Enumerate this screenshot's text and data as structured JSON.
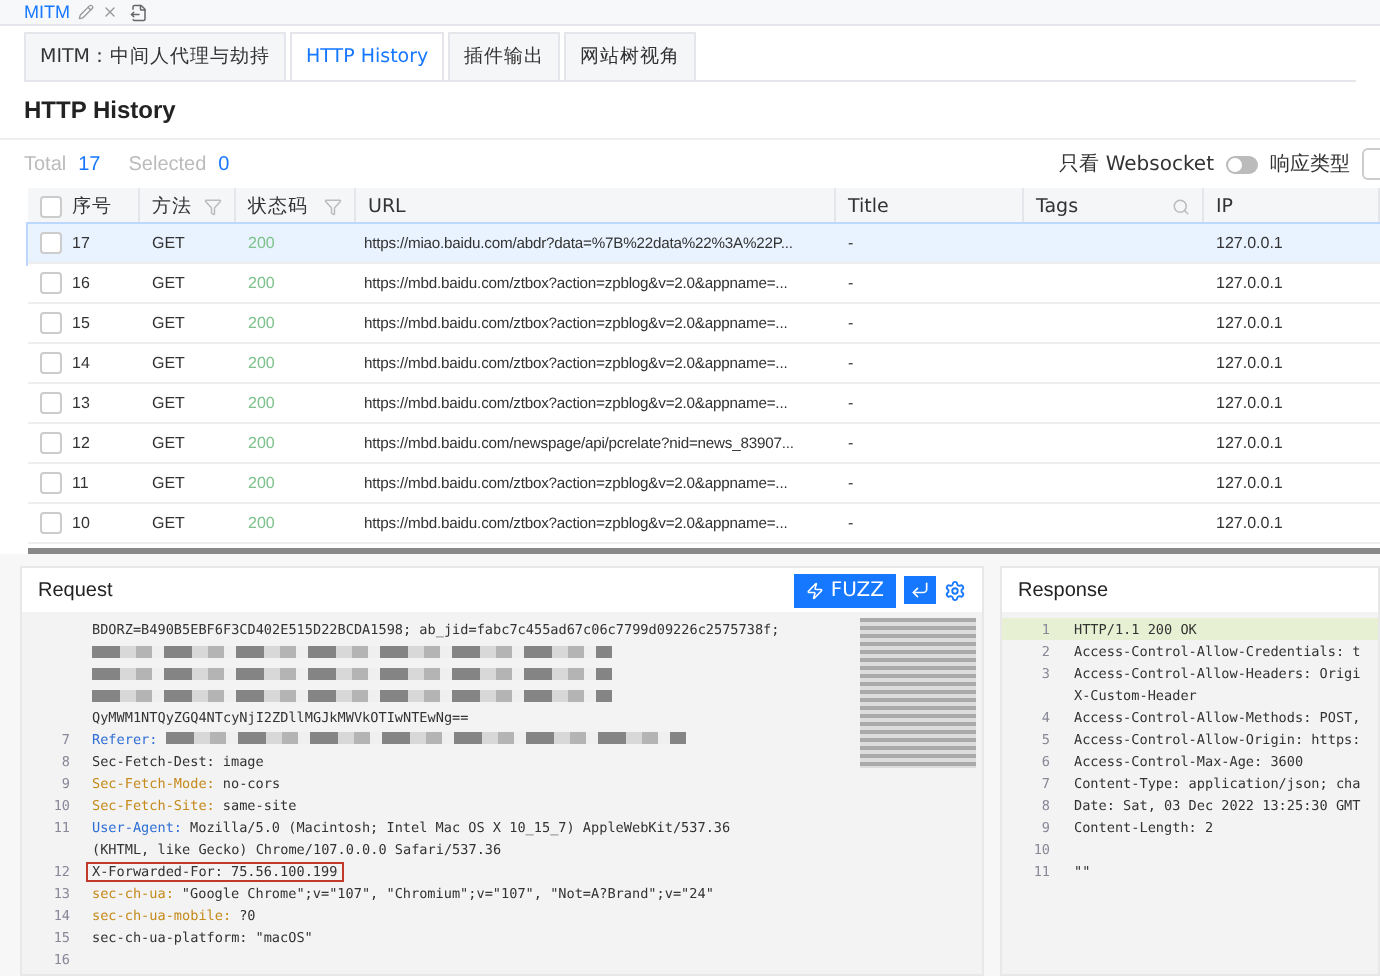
{
  "top_tab": {
    "label": "MITM"
  },
  "tabs": [
    {
      "label": "MITM：中间人代理与劫持",
      "selected": false
    },
    {
      "label": "HTTP History",
      "selected": true
    },
    {
      "label": "插件输出",
      "selected": false
    },
    {
      "label": "网站树视角",
      "selected": false
    }
  ],
  "title": "HTTP History",
  "summary": {
    "total_label": "Total",
    "total": "17",
    "selected_label": "Selected",
    "selected": "0"
  },
  "websocket_filter": {
    "label": "只看 Websocket",
    "on": false
  },
  "response_type": {
    "label": "响应类型"
  },
  "table": {
    "all_checked": false,
    "columns": [
      {
        "label": "序号",
        "kind": "check"
      },
      {
        "label": "方法",
        "kind": "filter"
      },
      {
        "label": "状态码",
        "kind": "filter"
      },
      {
        "label": "URL",
        "kind": "plain"
      },
      {
        "label": "Title",
        "kind": "plain"
      },
      {
        "label": "Tags",
        "kind": "search"
      },
      {
        "label": "IP",
        "kind": "plain"
      }
    ],
    "rows": [
      {
        "id": "17",
        "method": "GET",
        "status": "200",
        "url": "https://miao.baidu.com/abdr?data=%7B%22data%22%3A%22P...",
        "title": "-",
        "ip": "127.0.0.1",
        "selected": true,
        "checked": false
      },
      {
        "id": "16",
        "method": "GET",
        "status": "200",
        "url": "https://mbd.baidu.com/ztbox?action=zpblog&v=2.0&appname=...",
        "title": "-",
        "ip": "127.0.0.1",
        "selected": false,
        "checked": false
      },
      {
        "id": "15",
        "method": "GET",
        "status": "200",
        "url": "https://mbd.baidu.com/ztbox?action=zpblog&v=2.0&appname=...",
        "title": "-",
        "ip": "127.0.0.1",
        "selected": false,
        "checked": false
      },
      {
        "id": "14",
        "method": "GET",
        "status": "200",
        "url": "https://mbd.baidu.com/ztbox?action=zpblog&v=2.0&appname=...",
        "title": "-",
        "ip": "127.0.0.1",
        "selected": false,
        "checked": false
      },
      {
        "id": "13",
        "method": "GET",
        "status": "200",
        "url": "https://mbd.baidu.com/ztbox?action=zpblog&v=2.0&appname=...",
        "title": "-",
        "ip": "127.0.0.1",
        "selected": false,
        "checked": false
      },
      {
        "id": "12",
        "method": "GET",
        "status": "200",
        "url": "https://mbd.baidu.com/newspage/api/pcrelate?nid=news_83907...",
        "title": "-",
        "ip": "127.0.0.1",
        "selected": false,
        "checked": false
      },
      {
        "id": "11",
        "method": "GET",
        "status": "200",
        "url": "https://mbd.baidu.com/ztbox?action=zpblog&v=2.0&appname=...",
        "title": "-",
        "ip": "127.0.0.1",
        "selected": false,
        "checked": false
      },
      {
        "id": "10",
        "method": "GET",
        "status": "200",
        "url": "https://mbd.baidu.com/ztbox?action=zpblog&v=2.0&appname=...",
        "title": "-",
        "ip": "127.0.0.1",
        "selected": false,
        "checked": false
      }
    ]
  },
  "request": {
    "title": "Request",
    "fuzz_button": "FUZZ",
    "lines": [
      {
        "value": "BDORZ=B490B5EBF6F3CD402E515D22BCDA1598; ab_jid=fabc7c455ad67c06c7799d09226c2575738f;",
        "redacted": false,
        "boxed": false
      },
      {
        "redacted": true,
        "boxed": false
      },
      {
        "redacted": true,
        "boxed": false
      },
      {
        "redacted": true,
        "boxed": false
      },
      {
        "value": "QyMWM1NTQyZGQ4NTcyNjI2ZDllMGJkMWVkOTIwNTEwNg==",
        "redacted": false,
        "boxed": false
      },
      {
        "number": "7",
        "key": "Referer:",
        "kind": "primary",
        "redacted": true,
        "boxed": false
      },
      {
        "number": "8",
        "key": "Sec-Fetch-Dest:",
        "value": "image",
        "kind": "plain",
        "redacted": false,
        "boxed": false
      },
      {
        "number": "9",
        "key": "Sec-Fetch-Mode:",
        "value": "no-cors",
        "kind": "accent",
        "redacted": false,
        "boxed": false
      },
      {
        "number": "10",
        "key": "Sec-Fetch-Site:",
        "value": "same-site",
        "kind": "accent",
        "redacted": false,
        "boxed": false
      },
      {
        "number": "11",
        "key": "User-Agent:",
        "value": "Mozilla/5.0 (Macintosh; Intel Mac OS X 10_15_7) AppleWebKit/537.36",
        "kind": "primary",
        "redacted": false,
        "boxed": false
      },
      {
        "value": "(KHTML, like Gecko) Chrome/107.0.0.0 Safari/537.36",
        "redacted": false,
        "boxed": false
      },
      {
        "number": "12",
        "key": "X-Forwarded-For:",
        "value": "75.56.100.199",
        "kind": "plain",
        "redacted": false,
        "boxed": true
      },
      {
        "number": "13",
        "key": "sec-ch-ua:",
        "value": "\"Google Chrome\";v=\"107\", \"Chromium\";v=\"107\", \"Not=A?Brand\";v=\"24\"",
        "kind": "accent",
        "redacted": false,
        "boxed": false
      },
      {
        "number": "14",
        "key": "sec-ch-ua-mobile:",
        "value": "?0",
        "kind": "accent",
        "redacted": false,
        "boxed": false
      },
      {
        "number": "15",
        "key": "sec-ch-ua-platform:",
        "value": "\"macOS\"",
        "kind": "plain",
        "redacted": false,
        "boxed": false
      },
      {
        "number": "16",
        "redacted": false,
        "boxed": false
      }
    ]
  },
  "response": {
    "title": "Response",
    "lines": [
      {
        "number": "1",
        "text": "HTTP/1.1 200 OK",
        "highlighted": true
      },
      {
        "number": "2",
        "text": "Access-Control-Allow-Credentials: t",
        "highlighted": false
      },
      {
        "number": "3",
        "text": "Access-Control-Allow-Headers: Origi",
        "highlighted": false
      },
      {
        "text": "X-Custom-Header",
        "highlighted": false
      },
      {
        "number": "4",
        "text": "Access-Control-Allow-Methods: POST,",
        "highlighted": false
      },
      {
        "number": "5",
        "text": "Access-Control-Allow-Origin: https:",
        "highlighted": false
      },
      {
        "number": "6",
        "text": "Access-Control-Max-Age: 3600",
        "highlighted": false
      },
      {
        "number": "7",
        "text": "Content-Type: application/json; cha",
        "highlighted": false
      },
      {
        "number": "8",
        "text": "Date: Sat, 03 Dec 2022 13:25:30 GMT",
        "highlighted": false
      },
      {
        "number": "9",
        "text": "Content-Length: 2",
        "highlighted": false
      },
      {
        "number": "10",
        "highlighted": false
      },
      {
        "number": "11",
        "text": "\"\"",
        "highlighted": false
      }
    ]
  }
}
